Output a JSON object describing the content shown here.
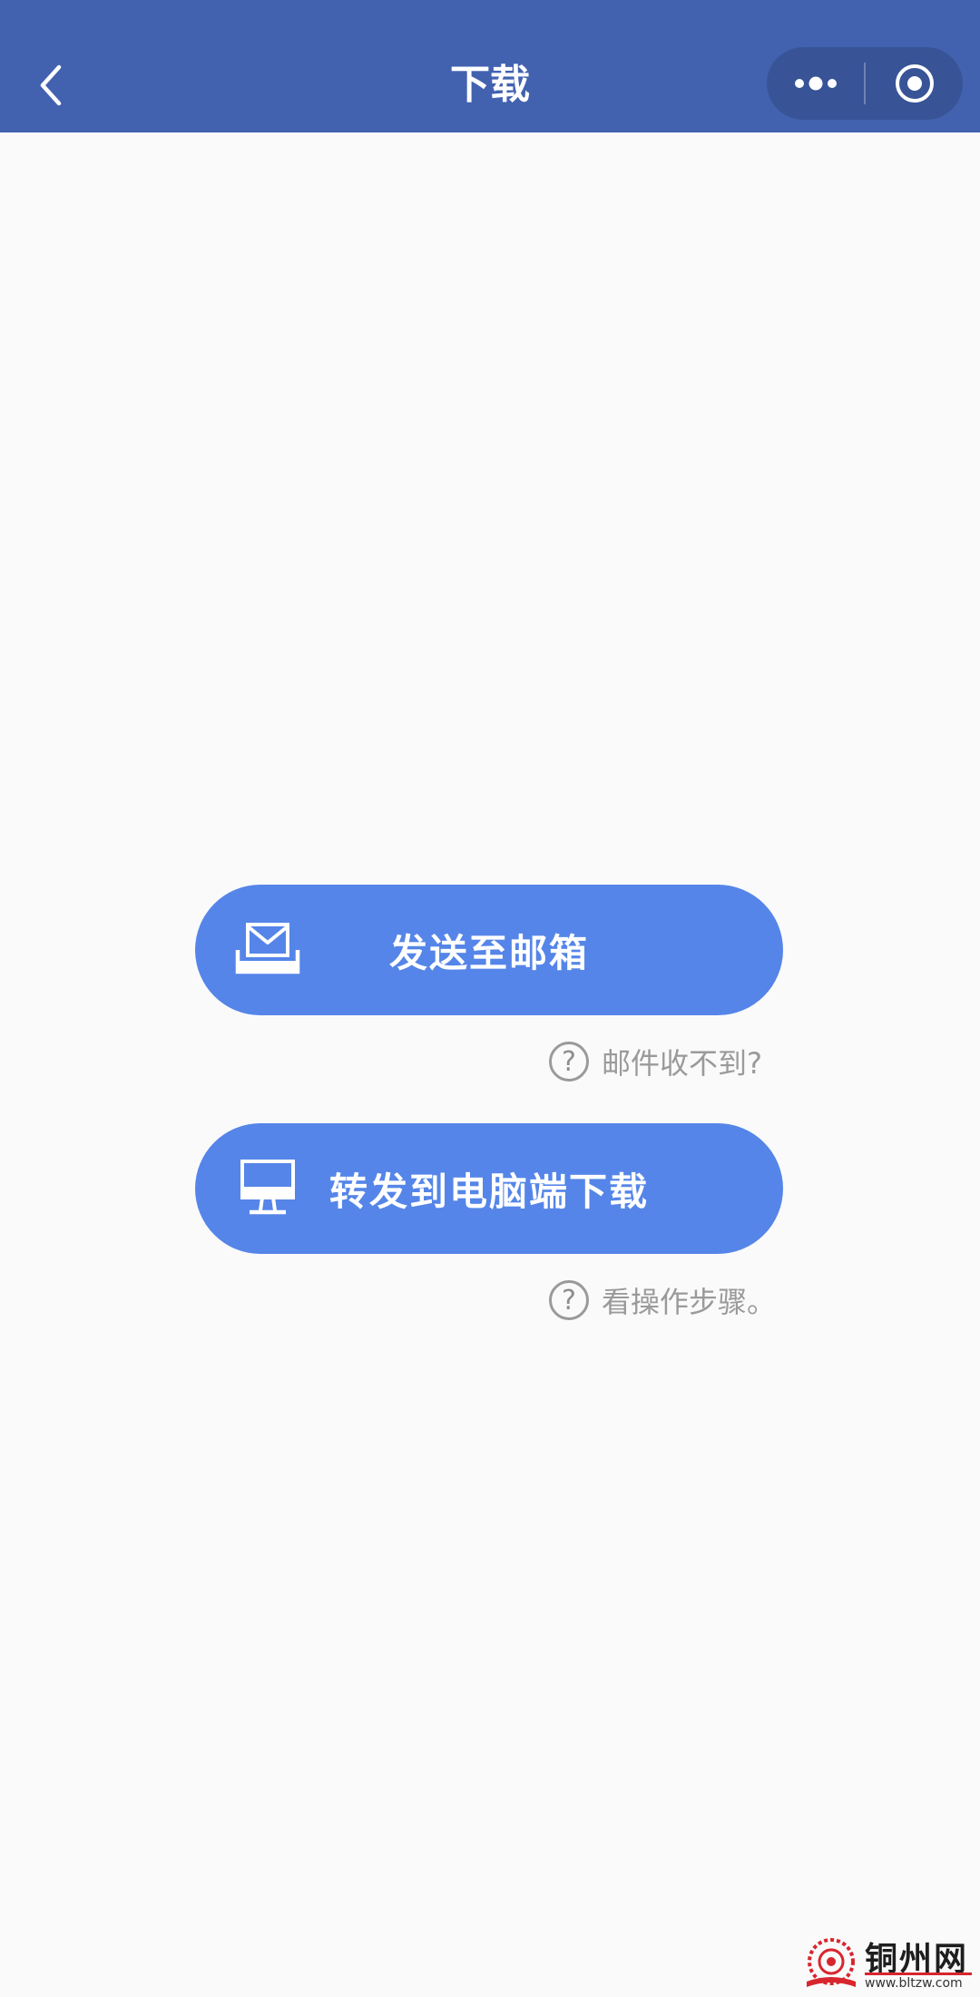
{
  "header": {
    "title": "下载",
    "colors": {
      "background": "#4262b0",
      "text": "#ffffff"
    }
  },
  "actions": {
    "send_email_label": "发送至邮箱",
    "forward_pc_label": "转发到电脑端下载",
    "button_color": "#5585e8"
  },
  "help": {
    "email_help": "邮件收不到?",
    "steps_help": "看操作步骤。",
    "question_mark": "?"
  },
  "watermark": {
    "name": "铜州网",
    "url": "www.bltzw.com"
  },
  "icons": {
    "back": "chevron-left-icon",
    "more": "more-dots-icon",
    "close": "target-circle-icon",
    "email": "inbox-tray-icon",
    "pc": "monitor-icon"
  }
}
